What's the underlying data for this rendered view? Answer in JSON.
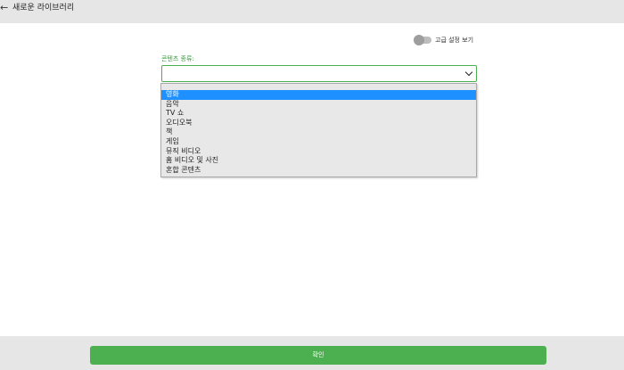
{
  "header": {
    "back_icon": "←",
    "title": "새로운 라이브러리"
  },
  "advanced_toggle": {
    "label": "고급 설정 보기",
    "on": false
  },
  "content_type": {
    "label": "콘텐츠 종류:",
    "value": "",
    "options": [
      "영화",
      "음악",
      "TV 쇼",
      "오디오북",
      "책",
      "게임",
      "뮤직 비디오",
      "홈 비디오 및 사진",
      "혼합 콘텐츠"
    ],
    "highlighted": 0
  },
  "footer": {
    "confirm_label": "확인"
  },
  "colors": {
    "accent": "#4caf50",
    "highlight": "#1e90ff",
    "bar": "#e6e6e6"
  }
}
